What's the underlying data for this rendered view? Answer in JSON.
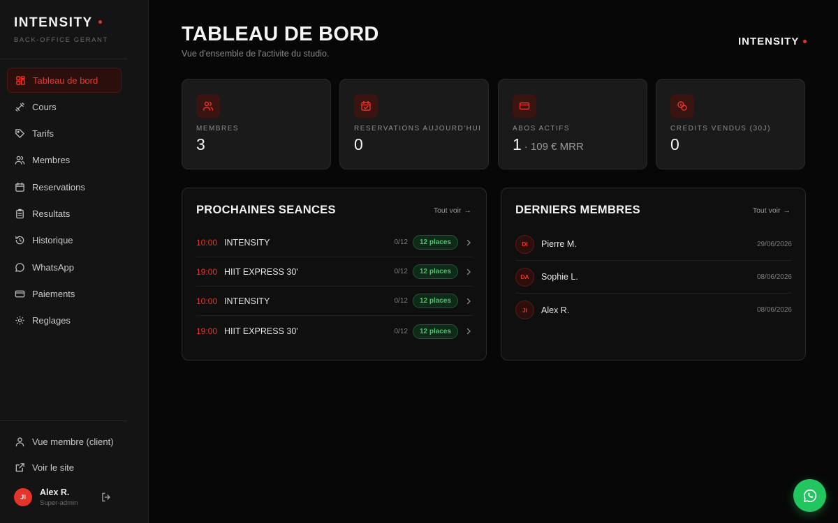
{
  "brand": {
    "name": "INTENSITY",
    "subtitle": "BACK-OFFICE GERANT"
  },
  "sidebar": {
    "items": [
      {
        "label": "Tableau de bord",
        "icon": "dashboard-icon",
        "active": true
      },
      {
        "label": "Cours",
        "icon": "dumbbell-icon"
      },
      {
        "label": "Tarifs",
        "icon": "tag-icon"
      },
      {
        "label": "Membres",
        "icon": "users-icon"
      },
      {
        "label": "Reservations",
        "icon": "calendar-icon"
      },
      {
        "label": "Resultats",
        "icon": "clipboard-icon"
      },
      {
        "label": "Historique",
        "icon": "history-icon"
      },
      {
        "label": "WhatsApp",
        "icon": "chat-icon"
      },
      {
        "label": "Paiements",
        "icon": "credit-card-icon"
      },
      {
        "label": "Reglages",
        "icon": "gear-icon"
      }
    ],
    "bottom_links": [
      {
        "label": "Vue membre (client)",
        "icon": "user-icon"
      },
      {
        "label": "Voir le site",
        "icon": "external-link-icon"
      }
    ],
    "user": {
      "initials": "JI",
      "name": "Alex R.",
      "role": "Super-admin"
    }
  },
  "header": {
    "title": "TABLEAU DE BORD",
    "subtitle": "Vue d'ensemble de l'activite du studio.",
    "brand": "INTENSITY"
  },
  "stats": [
    {
      "label": "MEMBRES",
      "value": "3",
      "extra": "",
      "icon": "users-icon"
    },
    {
      "label": "RESERVATIONS AUJOURD'HUI",
      "value": "0",
      "extra": "",
      "icon": "calendar-check-icon"
    },
    {
      "label": "ABOS ACTIFS",
      "value": "1",
      "extra": "· 109 € MRR",
      "icon": "credit-card-icon"
    },
    {
      "label": "CREDITS VENDUS (30J)",
      "value": "0",
      "extra": "",
      "icon": "coins-icon"
    }
  ],
  "sessions_panel": {
    "title": "PROCHAINES SEANCES",
    "link": "Tout voir",
    "rows": [
      {
        "time": "10:00",
        "name": "INTENSITY",
        "count": "0/12",
        "places": "12 places"
      },
      {
        "time": "19:00",
        "name": "HIIT EXPRESS 30'",
        "count": "0/12",
        "places": "12 places"
      },
      {
        "time": "10:00",
        "name": "INTENSITY",
        "count": "0/12",
        "places": "12 places"
      },
      {
        "time": "19:00",
        "name": "HIIT EXPRESS 30'",
        "count": "0/12",
        "places": "12 places"
      }
    ]
  },
  "members_panel": {
    "title": "DERNIERS MEMBRES",
    "link": "Tout voir",
    "rows": [
      {
        "initials": "DI",
        "name": "Pierre M.",
        "date": "29/06/2026"
      },
      {
        "initials": "DA",
        "name": "Sophie L.",
        "date": "08/06/2026"
      },
      {
        "initials": "JI",
        "name": "Alex R.",
        "date": "08/06/2026"
      }
    ]
  },
  "colors": {
    "accent": "#e5352b",
    "success": "#22c55e",
    "background": "#070707"
  },
  "fab": {
    "icon": "whatsapp-icon"
  }
}
